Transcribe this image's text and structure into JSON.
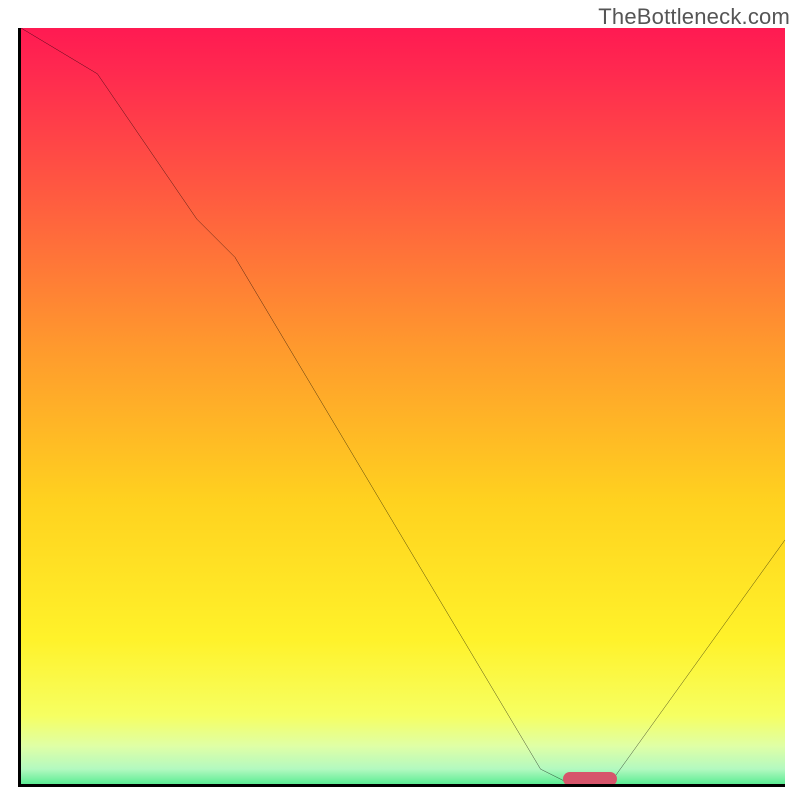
{
  "watermark": "TheBottleneck.com",
  "chart_data": {
    "type": "line",
    "title": "",
    "xlabel": "",
    "ylabel": "",
    "xlim": [
      0,
      100
    ],
    "ylim": [
      0,
      100
    ],
    "series": [
      {
        "name": "bottleneck-curve",
        "x": [
          0,
          10,
          23,
          28,
          68,
          72,
          77,
          100
        ],
        "values": [
          100,
          94,
          75,
          70,
          3,
          1,
          1,
          33
        ]
      }
    ],
    "marker": {
      "x_start": 71,
      "x_end": 78,
      "y": 0.6
    },
    "gradient_stops": [
      {
        "pct": 0,
        "color": "#ff1a52"
      },
      {
        "pct": 6,
        "color": "#ff2a4f"
      },
      {
        "pct": 22,
        "color": "#ff5b40"
      },
      {
        "pct": 42,
        "color": "#ff9a2d"
      },
      {
        "pct": 62,
        "color": "#ffd21f"
      },
      {
        "pct": 80,
        "color": "#fff22a"
      },
      {
        "pct": 90,
        "color": "#f6ff62"
      },
      {
        "pct": 94,
        "color": "#dfffa6"
      },
      {
        "pct": 97,
        "color": "#b3f9c0"
      },
      {
        "pct": 100,
        "color": "#2de57c"
      }
    ]
  }
}
